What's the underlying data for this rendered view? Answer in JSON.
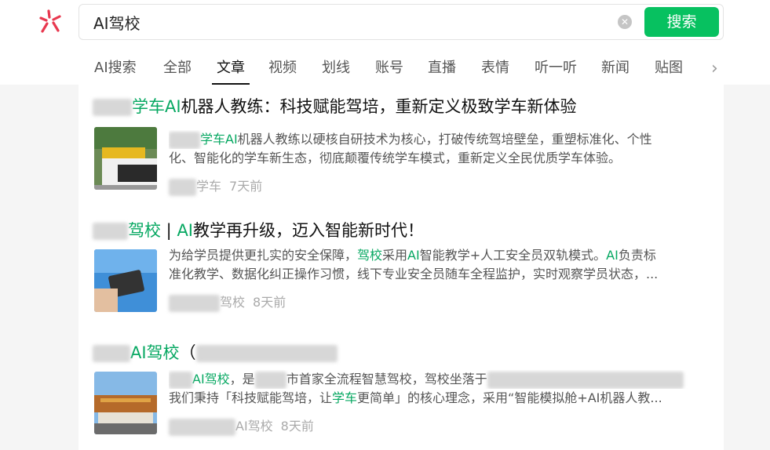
{
  "search": {
    "query": "AI驾校",
    "clear_icon": "clear-icon",
    "button_label": "搜索",
    "accent": "#07c160"
  },
  "brand": {
    "logo_icon": "sogou-weixin-logo-icon",
    "logo_color": "#e8384f"
  },
  "tabs": [
    {
      "label": "AI搜索"
    },
    {
      "label": "全部"
    },
    {
      "label": "文章",
      "active": true
    },
    {
      "label": "视频"
    },
    {
      "label": "划线"
    },
    {
      "label": "账号"
    },
    {
      "label": "直播"
    },
    {
      "label": "表情"
    },
    {
      "label": "听一听"
    },
    {
      "label": "新闻"
    },
    {
      "label": "贴图"
    }
  ],
  "tabs_more_icon": "chevron-right-icon",
  "results": [
    {
      "title_hl": "学车AI",
      "title_rest": "机器人教练：科技赋能驾培，重新定义极致学车新体验",
      "snippet_line1_hl": "学车AI",
      "snippet_line1_rest": "机器人教练以硬核自研技术为核心，打破传统驾培壁垒，重塑标准化、个性",
      "snippet_line2": "化、智能化的学车新生态，彻底颠覆传统学车模式，重新定义全民优质学车体验。",
      "source": "学车",
      "time": "7天前"
    },
    {
      "title_hl1": "驾校",
      "title_sep": " | ",
      "title_hl2": "AI",
      "title_rest": "教学再升级，迈入智能新时代！",
      "snippet_line1_a": "为给学员提供更扎实的安全保障，",
      "snippet_line1_hl1": "驾校",
      "snippet_line1_b": "采用",
      "snippet_line1_hl2": "AI",
      "snippet_line1_c": "智能教学+人工安全员双轨模式。",
      "snippet_line1_hl3": "AI",
      "snippet_line1_d": "负责标",
      "snippet_line2": "准化教学、数据化纠正操作习惯，线下专业安全员随车全程监护，实时观察学员状态，...",
      "source": "驾校",
      "time": "8天前"
    },
    {
      "title_hl": "AI驾校",
      "title_rest": "（",
      "snippet_line1_hl": "AI驾校",
      "snippet_line1_a": "，是",
      "snippet_line1_b": "市首家全流程智慧驾校，驾校坐落于",
      "snippet_line2_a": "我们秉持「科技赋能驾培，让",
      "snippet_line2_hl": "学车",
      "snippet_line2_b": "更简单」的核心理念，采用“智能模拟舱+AI机器人教...",
      "source": "AI驾校",
      "time": "8天前"
    }
  ]
}
